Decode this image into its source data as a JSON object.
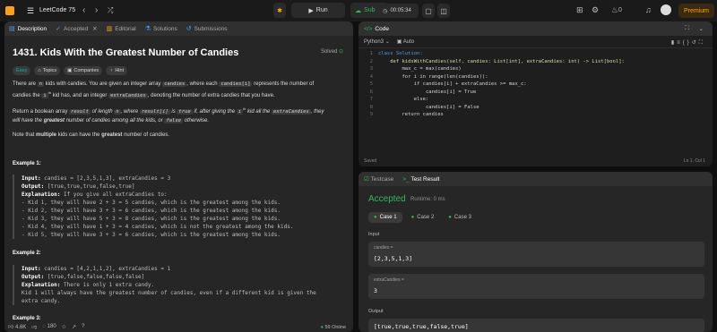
{
  "topbar": {
    "brand": "LeetCode 75",
    "run_label": "Run",
    "submit_label": "Submit",
    "timer": "00:05:34",
    "fire_count": "0",
    "premium_label": "Premium"
  },
  "left": {
    "tabs": [
      {
        "label": "Description"
      },
      {
        "label": "Accepted"
      },
      {
        "label": "Editorial"
      },
      {
        "label": "Solutions"
      },
      {
        "label": "Submissions"
      }
    ],
    "title": "1431. Kids With the Greatest Number of Candies",
    "solved": "Solved",
    "chips": {
      "easy": "Easy",
      "topics": "Topics",
      "companies": "Companies",
      "hint": "Hint"
    },
    "p1": {
      "a": "There are ",
      "n": "n",
      "b": " kids with candies. You are given an integer array ",
      "c": "candies",
      "d": ", where each ",
      "e": "candies[i]",
      "f": " represents the number of",
      "g": "candies the ",
      "h": "i",
      "sup": "th",
      "i": " kid has, and an integer ",
      "j": "extraCandies",
      "k": ", denoting the number of extra candies that you have."
    },
    "p2": {
      "a": "Return a boolean array ",
      "b": "result",
      "c": " of length ",
      "d": "n",
      "e": ", where ",
      "f": "result[i]",
      "g": " is ",
      "h": "true",
      "i": " if, after giving the ",
      "j": "i",
      "sup": "th",
      "k": " kid all the ",
      "l": "extraCandies",
      "m": ", they",
      "n2": "will have the ",
      "o": "greatest",
      "p": " number of candies among all the kids, or ",
      "q": "false",
      "r": " otherwise."
    },
    "p3": {
      "a": "Note that ",
      "b": "multiple",
      "c": " kids can have the ",
      "d": "greatest",
      "e": " number of candies."
    },
    "ex1_title": "Example 1:",
    "ex1": {
      "input_label": "Input:",
      "input": " candies = [2,3,5,1,3], extraCandies = 3",
      "output_label": "Output:",
      "output": " [true,true,true,false,true]",
      "expl_label": "Explanation:",
      "expl": " If you give all extraCandies to:",
      "lines": [
        "- Kid 1, they will have 2 + 3 = 5 candies, which is the greatest among the kids.",
        "- Kid 2, they will have 3 + 3 = 6 candies, which is the greatest among the kids.",
        "- Kid 3, they will have 5 + 3 = 8 candies, which is the greatest among the kids.",
        "- Kid 4, they will have 1 + 3 = 4 candies, which is not the greatest among the kids.",
        "- Kid 5, they will have 3 + 3 = 6 candies, which is the greatest among the kids."
      ]
    },
    "ex2_title": "Example 2:",
    "ex2": {
      "input_label": "Input:",
      "input": " candies = [4,2,1,1,2], extraCandies = 1",
      "output_label": "Output:",
      "output": " [true,false,false,false,false]",
      "expl_label": "Explanation:",
      "expl": " There is only 1 extra candy.",
      "lines": [
        "Kid 1 will always have the greatest number of candies, even if a different kid is given the",
        "extra candy."
      ]
    },
    "ex3_title": "Example 3:",
    "footer": {
      "likes": "4.6K",
      "comments": "180",
      "online": "59 Online"
    }
  },
  "code": {
    "title": "Code",
    "language": "Python3",
    "auto": "Auto",
    "lines": [
      "class Solution:",
      "    def kidsWithCandies(self, candies: List[int], extraCandies: int) -> List[bool]:",
      "        max_c = max(candies)",
      "        for i in range(len(candies)):",
      "            if candies[i] + extraCandies >= max_c:",
      "                candies[i] = True",
      "            else:",
      "                candies[i] = False",
      "        return candies"
    ],
    "line_numbers": [
      "1",
      "2",
      "3",
      "4",
      "5",
      "6",
      "7",
      "8",
      "9"
    ],
    "saved": "Saved",
    "cursor": "Ln 1, Col 1"
  },
  "test": {
    "tab_testcase": "Testcase",
    "tab_result": "Test Result",
    "status": "Accepted",
    "runtime": "Runtime: 0 ms",
    "cases": [
      "Case 1",
      "Case 2",
      "Case 3"
    ],
    "input_label": "Input",
    "var1_label": "candies =",
    "var1_value": "[2,3,5,1,3]",
    "var2_label": "extraCandies =",
    "var2_value": "3",
    "output_label": "Output",
    "output_value": "[true,true,true,false,true]"
  },
  "colors": {
    "accent_green": "#2cbb5d",
    "brand_orange": "#ffa116",
    "easy": "#00b8a3"
  }
}
